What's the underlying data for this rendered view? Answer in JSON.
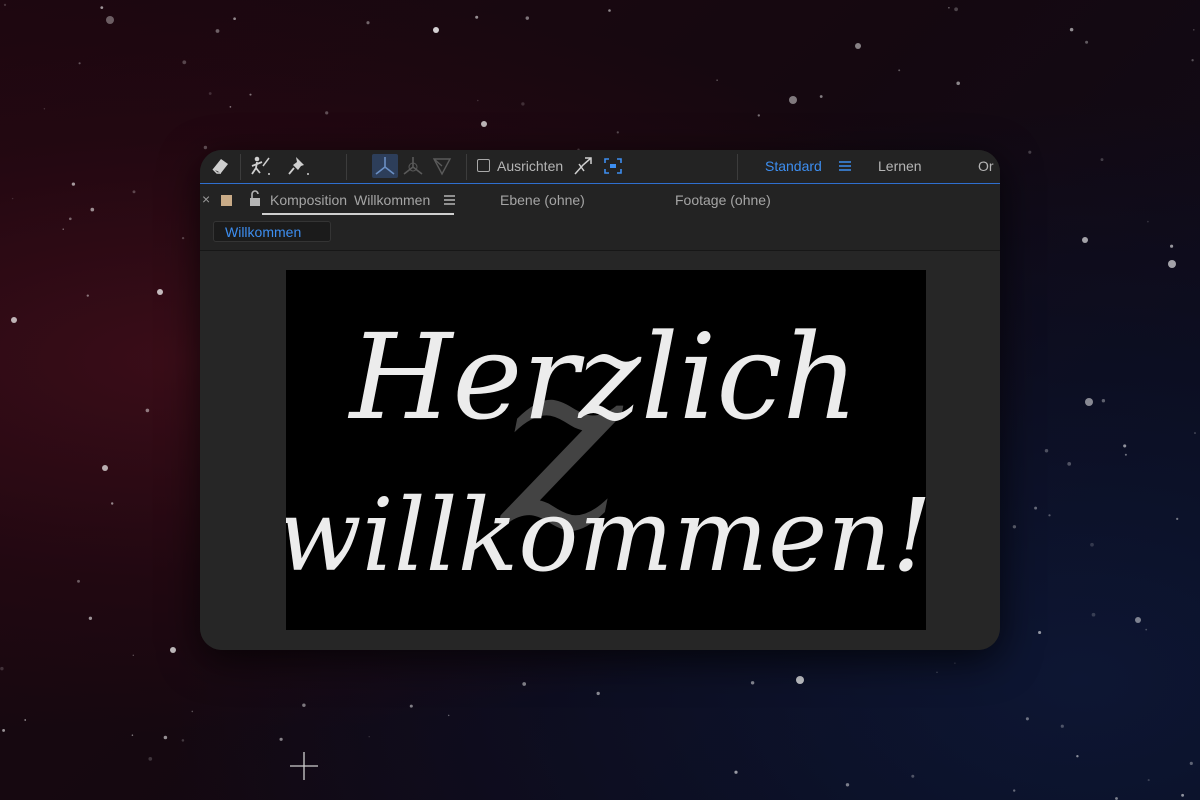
{
  "toolbar": {
    "tools": [
      {
        "name": "eraser-tool-icon"
      },
      {
        "name": "puppet-tool-icon"
      },
      {
        "name": "pin-tool-icon"
      }
    ],
    "axis_modes": [
      {
        "name": "local-axis-icon"
      },
      {
        "name": "world-axis-icon"
      },
      {
        "name": "view-axis-icon"
      }
    ],
    "snap_label": "Ausrichten",
    "workspaces": {
      "active": "Standard",
      "learn": "Lernen",
      "partial": "Or"
    }
  },
  "panel": {
    "close_glyph": "×",
    "composition_label": "Komposition",
    "composition_name": "Willkommen",
    "layer_tab": "Ebene (ohne)",
    "footage_tab": "Footage (ohne)",
    "breadcrumb": "Willkommen"
  },
  "canvas": {
    "line1": "Herzlich",
    "line2": "willkommen!",
    "ghost_glyph": "z"
  },
  "colors": {
    "accent": "#3d8ef0",
    "label_swatch": "#c9ab87",
    "panel_bg": "#232323"
  }
}
